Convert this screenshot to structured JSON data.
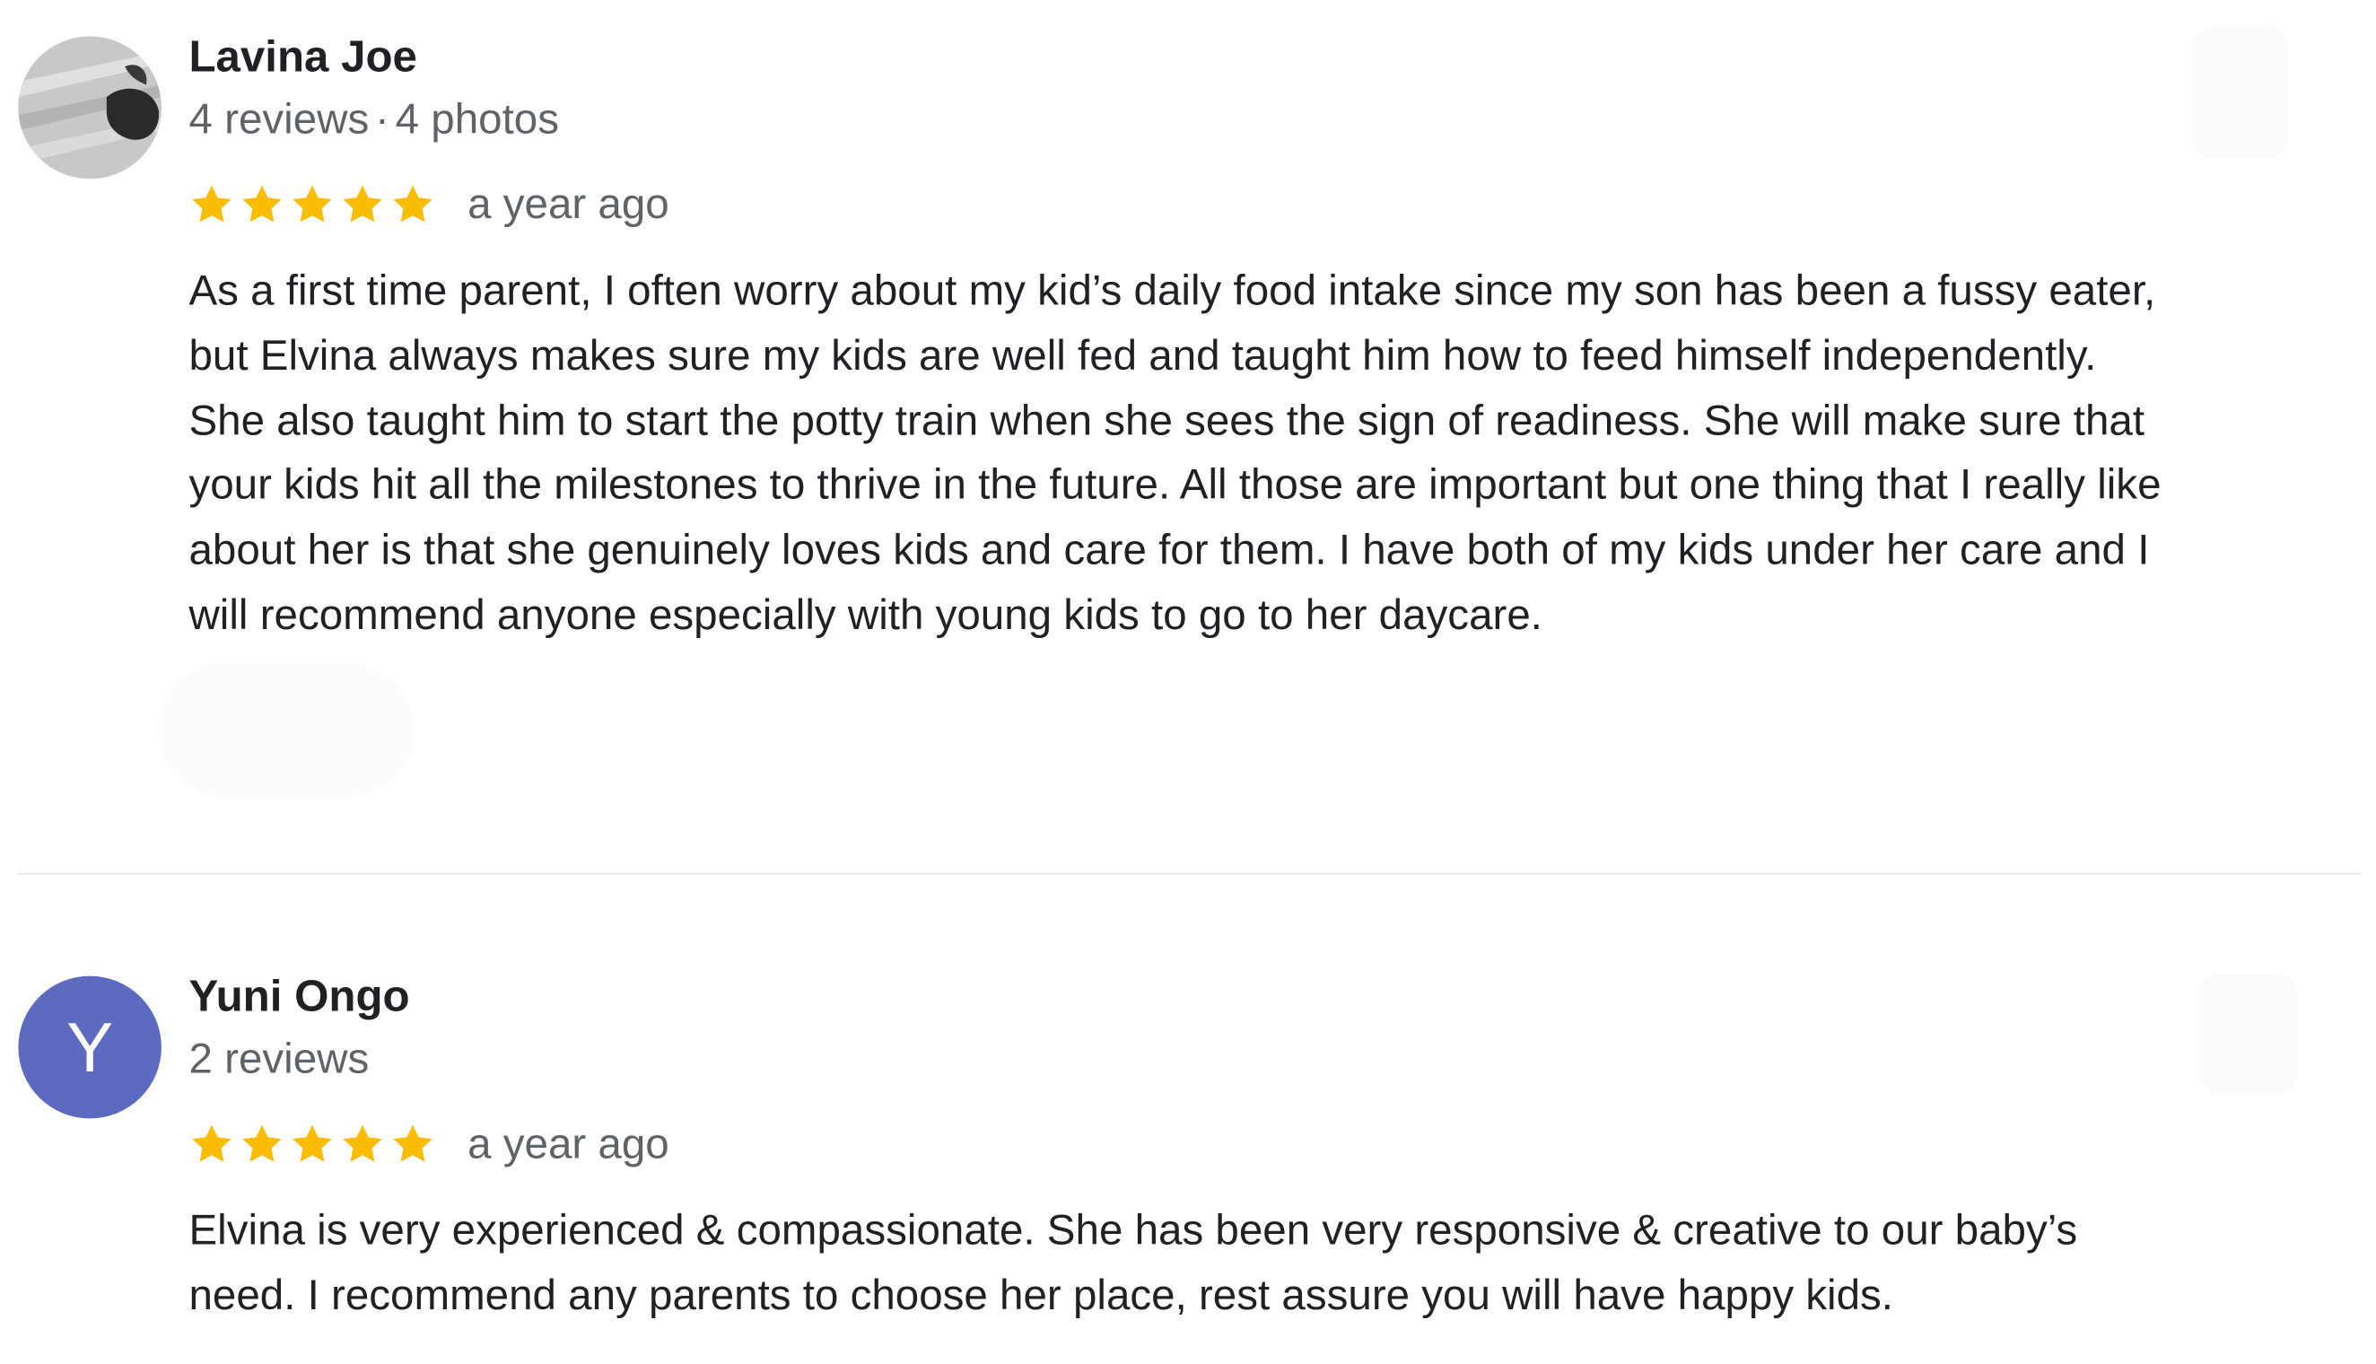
{
  "reviews": [
    {
      "author": "Lavina Joe",
      "reviews_count": "4 reviews",
      "separator": "·",
      "photos_count": "4 photos",
      "rating": 5,
      "date": "a year ago",
      "text": "As a first time parent, I often worry about my kid’s daily food intake since my son has been a fussy eater,\nbut Elvina always makes sure my kids are well fed and taught him how to feed himself independently.\nShe also taught him to start the potty train when she sees the sign of readiness. She will make sure that\nyour kids hit all the milestones to thrive in the future. All those are important but one thing that I really like\nabout her is that she genuinely loves kids and care for them. I have both of my kids under her care and I\nwill recommend anyone especially with young kids to go to her daycare.",
      "avatar": {
        "type": "photo"
      }
    },
    {
      "author": "Yuni Ongo",
      "reviews_count": "2 reviews",
      "rating": 5,
      "date": "a year ago",
      "text": "Elvina is very experienced & compassionate. She has been very responsive & creative to our baby’s\nneed. I recommend any parents to choose her place, rest assure you will have happy kids.",
      "avatar": {
        "type": "letter",
        "letter": "Y",
        "color": "#5c6bc0"
      }
    }
  ],
  "colors": {
    "star": "#fbbc04",
    "text": "#202124",
    "secondary_text": "#5f6368",
    "divider": "#e3e3e3"
  },
  "icons": {
    "star": "star-icon",
    "more": "more-options-icon"
  }
}
